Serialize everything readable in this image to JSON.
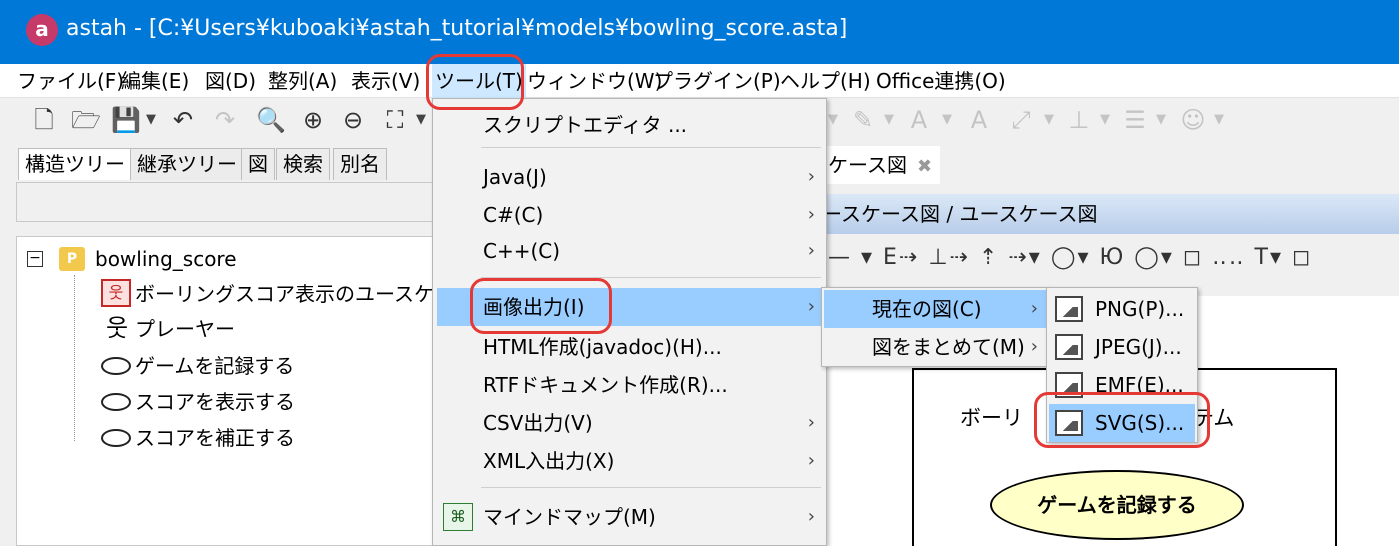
{
  "app": {
    "logo": "a",
    "title": "astah - [C:¥Users¥kuboaki¥astah_tutorial¥models¥bowling_score.asta]"
  },
  "menubar": [
    "ファイル(F)",
    "編集(E)",
    "図(D)",
    "整列(A)",
    "表示(V)",
    "ツール(T)",
    "ウィンドウ(W)",
    "プラグイン(P)",
    "ヘルプ(H)",
    "Office連携(O)"
  ],
  "toolbar": {
    "icons": [
      "new-file-icon",
      "open-folder-icon",
      "save-icon",
      "undo-icon",
      "redo-icon",
      "search-icon",
      "zoom-in-icon",
      "zoom-out-icon",
      "fit-window-icon"
    ],
    "right_icons": [
      "pen-icon",
      "font-color-icon",
      "font-size-icon",
      "line-style-icon",
      "align-icon",
      "stack-icon",
      "emoji-icon"
    ]
  },
  "left_tabs": [
    "構造ツリー",
    "継承ツリー",
    "図",
    "検索",
    "別名"
  ],
  "tree": {
    "root": "bowling_score",
    "root_badge": "P",
    "items": [
      "ボーリングスコア表示のユースケー",
      "プレーヤー",
      "ゲームを記録する",
      "スコアを表示する",
      "スコアを補正する"
    ]
  },
  "diagram": {
    "tab_label": "ケース図",
    "header": "ースケース図 / ユースケース図",
    "system_title": "ボーリ",
    "system_title_tail": "システム",
    "usecase": "ゲームを記録する"
  },
  "tool_menu": {
    "script_editor": "スクリプトエディタ ...",
    "java": "Java(J)",
    "csharp": "C#(C)",
    "cpp": "C++(C)",
    "image_export": "画像出力(I)",
    "html": "HTML作成(javadoc)(H)...",
    "rtf": "RTFドキュメント作成(R)...",
    "csv": "CSV出力(V)",
    "xml": "XML入出力(X)",
    "mindmap": "マインドマップ(M)"
  },
  "export_menu": {
    "current": "現在の図(C)",
    "batch": "図をまとめて(M)"
  },
  "format_menu": {
    "png": "PNG(P)...",
    "jpeg": "JPEG(J)...",
    "emf": "EMF(E)...",
    "svg": "SVG(S)..."
  },
  "submenu_arrow": "›",
  "colors": {
    "titlebar": "#0078d7",
    "menu_highlight": "#99ccff",
    "callout": "#e53935",
    "usecase_fill": "#ffffc8"
  }
}
